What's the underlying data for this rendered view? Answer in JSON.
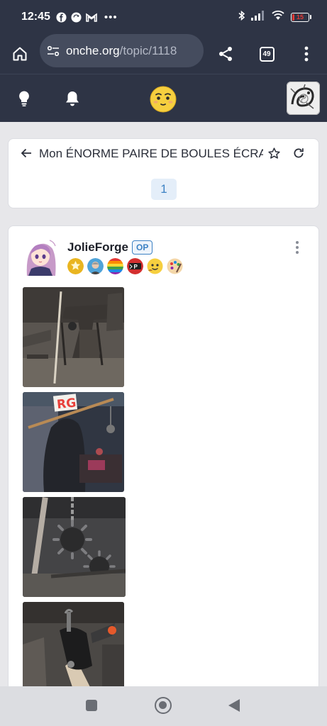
{
  "status_bar": {
    "time": "12:45",
    "battery": "15",
    "left_icons": [
      "facebook-icon",
      "sync-icon",
      "gmail-icon",
      "more-icon"
    ],
    "right_icons": [
      "bluetooth-icon",
      "signal-icon",
      "wifi-icon",
      "battery-icon"
    ]
  },
  "browser": {
    "url_domain": "onche.org",
    "url_path": "/topic/1118",
    "tab_count": "49"
  },
  "topic": {
    "title": "Mon ÉNORME PAIRE DE BOULES ÉCRA",
    "page": "1"
  },
  "post": {
    "author": "JolieForge",
    "op_label": "OP",
    "badges": [
      "star-badge",
      "portrait-badge",
      "rainbow-badge",
      "p-badge",
      "emoji-badge",
      "palette-badge"
    ],
    "images": [
      "forge-anvil-photo",
      "person-with-axe-photo",
      "spiked-ball-photo",
      "hammer-handle-photo"
    ]
  },
  "colors": {
    "header_bg": "#2e3445",
    "url_bg": "#454c5e",
    "accent": "#3d82c4",
    "page_bg": "#e7e7ea",
    "card_bg": "#ffffff"
  }
}
